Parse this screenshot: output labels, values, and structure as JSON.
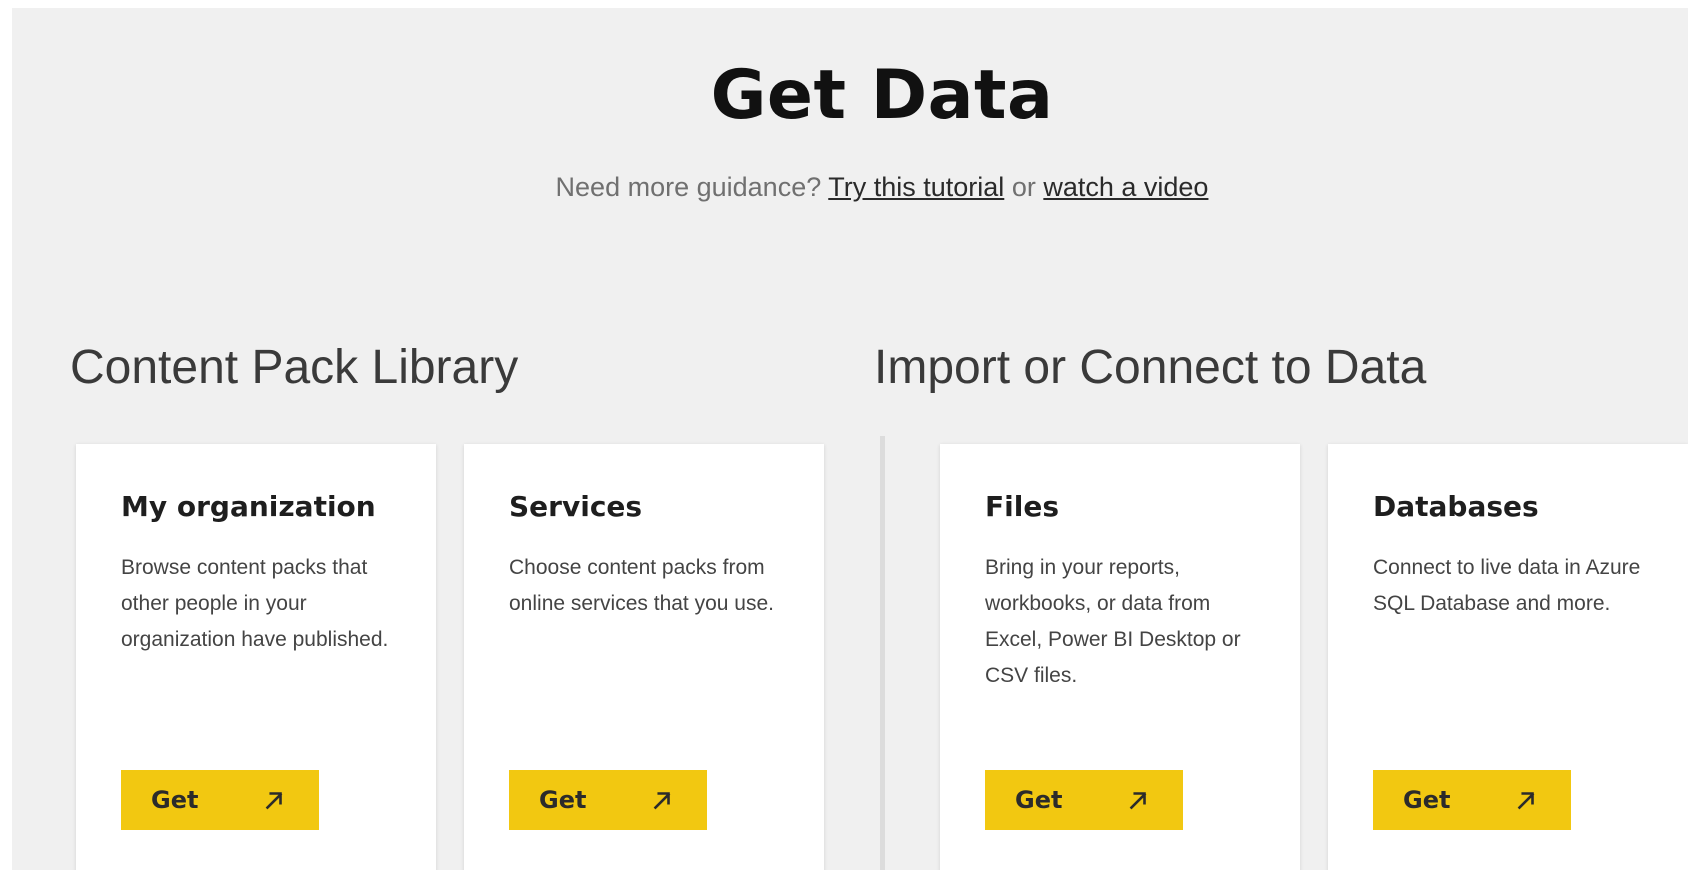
{
  "page": {
    "title": "Get Data",
    "guidance": {
      "prefix": "Need more guidance?",
      "tutorial_link": "Try this tutorial",
      "or_text": "or",
      "video_link": "watch a video"
    }
  },
  "sections": {
    "content_pack_library": {
      "heading": "Content Pack Library",
      "cards": [
        {
          "title": "My organization",
          "description": "Browse content packs that other people in your organization have published.",
          "button_label": "Get",
          "button_icon": "arrow-up-right-icon"
        },
        {
          "title": "Services",
          "description": "Choose content packs from online services that you use.",
          "button_label": "Get",
          "button_icon": "arrow-up-right-icon"
        }
      ]
    },
    "import_connect": {
      "heading": "Import or Connect to Data",
      "cards": [
        {
          "title": "Files",
          "description": "Bring in your reports, workbooks, or data from Excel, Power BI Desktop or CSV files.",
          "button_label": "Get",
          "button_icon": "arrow-up-right-icon"
        },
        {
          "title": "Databases",
          "description": "Connect to live data in Azure SQL Database and more.",
          "button_label": "Get",
          "button_icon": "arrow-up-right-icon"
        }
      ]
    }
  },
  "colors": {
    "background": "#f0f0f0",
    "card": "#ffffff",
    "button": "#f2c811"
  }
}
